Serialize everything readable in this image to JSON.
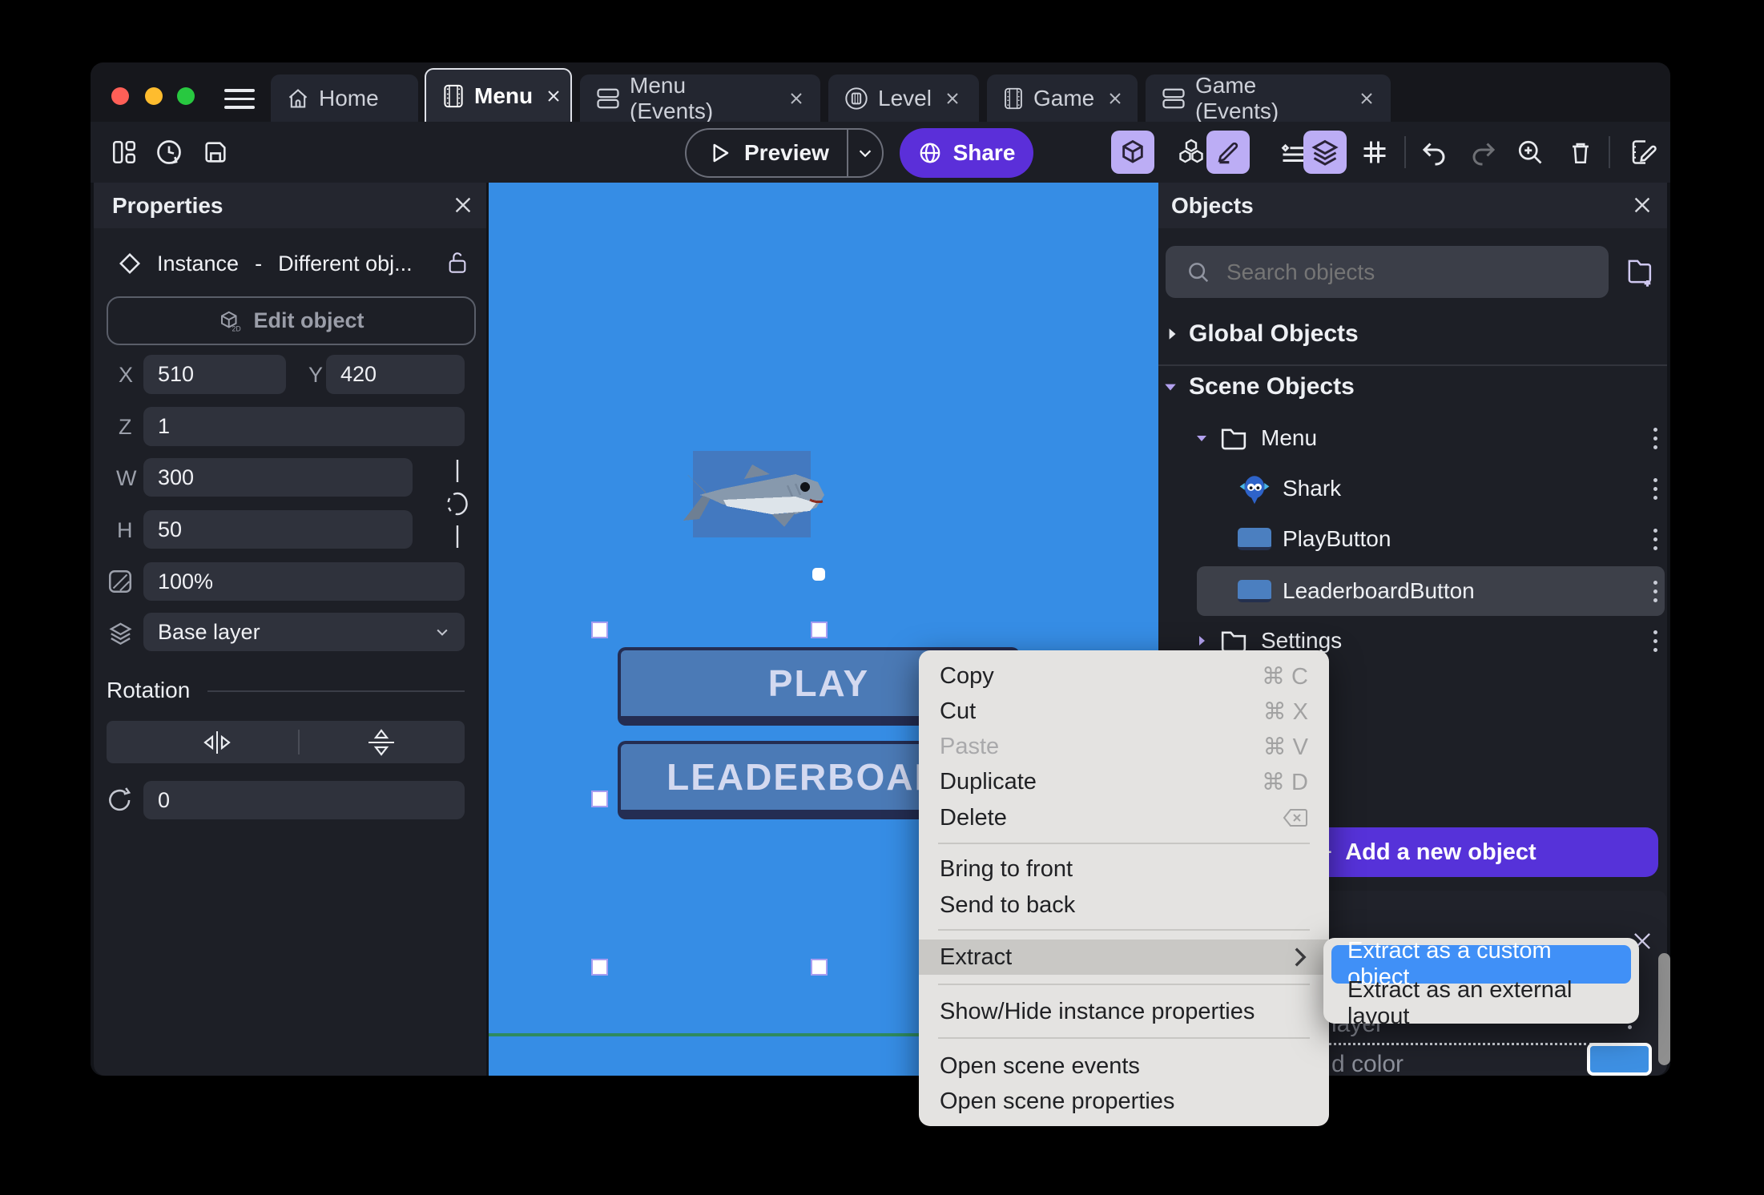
{
  "titlebar": {
    "tabs": [
      {
        "label": "Home"
      },
      {
        "label": "Menu"
      },
      {
        "label": "Menu (Events)"
      },
      {
        "label": "Level"
      },
      {
        "label": "Game"
      },
      {
        "label": "Game (Events)"
      }
    ]
  },
  "toolbar": {
    "preview_label": "Preview",
    "share_label": "Share"
  },
  "properties": {
    "title": "Properties",
    "instance_label": "Instance",
    "dash": "-",
    "object_label": "Different obj...",
    "edit_object_label": "Edit object",
    "edit_object_icon_sub": "2D",
    "x_label": "X",
    "x": "510",
    "y_label": "Y",
    "y": "420",
    "z_label": "Z",
    "z": "1",
    "w_label": "W",
    "w": "300",
    "h_label": "H",
    "h": "50",
    "opacity": "100%",
    "layer": "Base layer",
    "rotation_title": "Rotation",
    "rotation": "0"
  },
  "canvas": {
    "play_label": "PLAY",
    "leaderboard_label": "LEADERBOARD"
  },
  "context_menu": {
    "items": [
      {
        "label": "Copy",
        "shortcut": "⌘ C"
      },
      {
        "label": "Cut",
        "shortcut": "⌘ X"
      },
      {
        "label": "Paste",
        "shortcut": "⌘ V"
      },
      {
        "label": "Duplicate",
        "shortcut": "⌘ D"
      },
      {
        "label": "Delete"
      },
      {
        "label": "Bring to front"
      },
      {
        "label": "Send to back"
      },
      {
        "label": "Extract"
      },
      {
        "label": "Show/Hide instance properties"
      },
      {
        "label": "Open scene events"
      },
      {
        "label": "Open scene properties"
      }
    ]
  },
  "submenu": {
    "items": [
      {
        "label": "Extract as a custom object"
      },
      {
        "label": "Extract as an external layout"
      }
    ]
  },
  "objects_panel": {
    "title": "Objects",
    "search_placeholder": "Search objects",
    "global_label": "Global Objects",
    "scene_label": "Scene Objects",
    "tree": {
      "menu_folder": "Menu",
      "shark": "Shark",
      "play_button": "PlayButton",
      "leaderboard_button": "LeaderboardButton",
      "settings_folder": "Settings"
    },
    "add_button_label": "Add a new object",
    "add_button_plus": "+",
    "bottom_panel": {
      "layer_text": "layer",
      "color_text": "d color"
    }
  },
  "colors": {
    "accent_purple": "#5632d9",
    "share_purple": "#5b2fd9",
    "canvas_blue": "#368de5",
    "game_button_blue": "#4b7ab6",
    "submenu_highlight_blue": "#4090f7",
    "toolbar_toggle_purple": "#bcadf5",
    "color_swatch_blue": "#3e90e3",
    "ground_line_green": "#2e8a5f"
  }
}
